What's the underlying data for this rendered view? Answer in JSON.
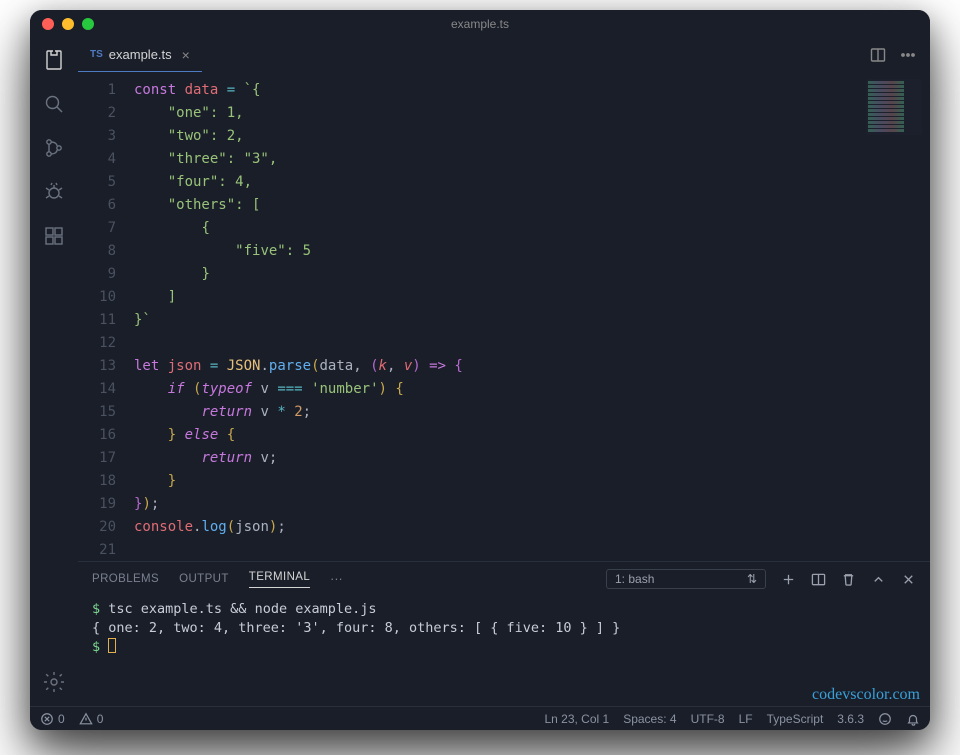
{
  "window": {
    "title": "example.ts"
  },
  "tab": {
    "lang": "TS",
    "filename": "example.ts"
  },
  "code": {
    "gutter_start": 1,
    "gutter_end": 21,
    "lines": [
      [
        [
          "kw2",
          "const "
        ],
        [
          "def",
          "data"
        ],
        [
          "pn",
          " "
        ],
        [
          "op",
          "="
        ],
        [
          "pn",
          " "
        ],
        [
          "str",
          "`{"
        ]
      ],
      [
        [
          "pn",
          "    "
        ],
        [
          "str",
          "\"one\": 1,"
        ]
      ],
      [
        [
          "pn",
          "    "
        ],
        [
          "str",
          "\"two\": 2,"
        ]
      ],
      [
        [
          "pn",
          "    "
        ],
        [
          "str",
          "\"three\": \"3\","
        ]
      ],
      [
        [
          "pn",
          "    "
        ],
        [
          "str",
          "\"four\": 4,"
        ]
      ],
      [
        [
          "pn",
          "    "
        ],
        [
          "str",
          "\"others\": ["
        ]
      ],
      [
        [
          "pn",
          "        "
        ],
        [
          "str",
          "{"
        ]
      ],
      [
        [
          "pn",
          "            "
        ],
        [
          "str",
          "\"five\": 5"
        ]
      ],
      [
        [
          "pn",
          "        "
        ],
        [
          "str",
          "}"
        ]
      ],
      [
        [
          "pn",
          "    "
        ],
        [
          "str",
          "]"
        ]
      ],
      [
        [
          "str",
          "}`"
        ]
      ],
      [],
      [
        [
          "kw2",
          "let "
        ],
        [
          "def",
          "json"
        ],
        [
          "pn",
          " "
        ],
        [
          "op",
          "="
        ],
        [
          "pn",
          " "
        ],
        [
          "cls",
          "JSON"
        ],
        [
          "pn",
          "."
        ],
        [
          "fn",
          "parse"
        ],
        [
          "brk",
          "("
        ],
        [
          "pn",
          "data"
        ],
        [
          "pn",
          ", "
        ],
        [
          "brk2",
          "("
        ],
        [
          "par",
          "k"
        ],
        [
          "pn",
          ", "
        ],
        [
          "par",
          "v"
        ],
        [
          "brk2",
          ")"
        ],
        [
          "pn",
          " "
        ],
        [
          "kw2",
          "=>"
        ],
        [
          "pn",
          " "
        ],
        [
          "brk2",
          "{"
        ]
      ],
      [
        [
          "pn",
          "    "
        ],
        [
          "kw",
          "if"
        ],
        [
          "pn",
          " "
        ],
        [
          "brk",
          "("
        ],
        [
          "kw",
          "typeof"
        ],
        [
          "pn",
          " v "
        ],
        [
          "op",
          "==="
        ],
        [
          "pn",
          " "
        ],
        [
          "str",
          "'number'"
        ],
        [
          "brk",
          ")"
        ],
        [
          "pn",
          " "
        ],
        [
          "brk",
          "{"
        ]
      ],
      [
        [
          "pn",
          "        "
        ],
        [
          "kw",
          "return"
        ],
        [
          "pn",
          " v "
        ],
        [
          "op",
          "*"
        ],
        [
          "pn",
          " "
        ],
        [
          "num",
          "2"
        ],
        [
          "pn",
          ";"
        ]
      ],
      [
        [
          "pn",
          "    "
        ],
        [
          "brk",
          "}"
        ],
        [
          "pn",
          " "
        ],
        [
          "kw",
          "else"
        ],
        [
          "pn",
          " "
        ],
        [
          "brk",
          "{"
        ]
      ],
      [
        [
          "pn",
          "        "
        ],
        [
          "kw",
          "return"
        ],
        [
          "pn",
          " v;"
        ]
      ],
      [
        [
          "pn",
          "    "
        ],
        [
          "brk",
          "}"
        ]
      ],
      [
        [
          "brk2",
          "}"
        ],
        [
          "brk",
          ")"
        ],
        [
          "pn",
          ";"
        ]
      ],
      [
        [
          "prop",
          "console"
        ],
        [
          "pn",
          "."
        ],
        [
          "fn",
          "log"
        ],
        [
          "brk",
          "("
        ],
        [
          "pn",
          "json"
        ],
        [
          "brk",
          ")"
        ],
        [
          "pn",
          ";"
        ]
      ],
      []
    ]
  },
  "panel": {
    "tabs": {
      "problems": "PROBLEMS",
      "output": "OUTPUT",
      "terminal": "TERMINAL"
    },
    "selector": "1: bash",
    "lines": [
      "$ tsc example.ts && node example.js",
      "{ one: 2, two: 4, three: '3', four: 8, others: [ { five: 10 } ] }",
      "$ "
    ]
  },
  "status": {
    "errors": "0",
    "warnings": "0",
    "cursor": "Ln 23, Col 1",
    "spaces": "Spaces: 4",
    "encoding": "UTF-8",
    "eol": "LF",
    "language": "TypeScript",
    "version": "3.6.3"
  },
  "watermark": "codevscolor.com"
}
